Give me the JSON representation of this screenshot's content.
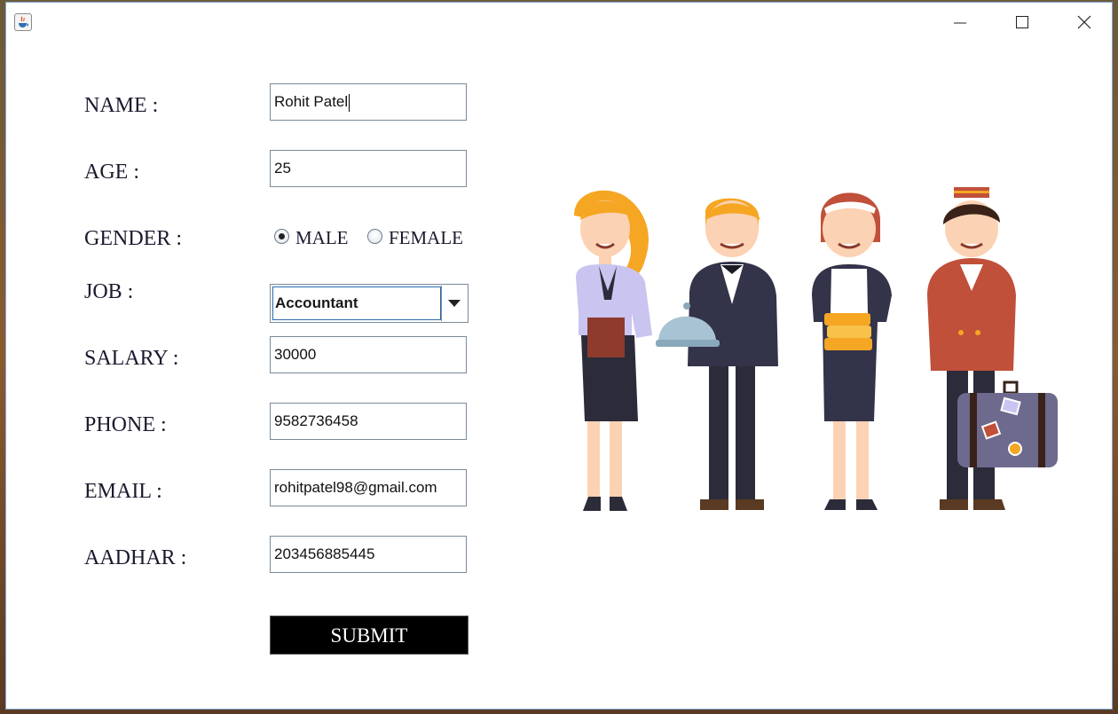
{
  "window": {
    "controls": {
      "minimize": "minimize",
      "maximize": "maximize",
      "close": "close"
    }
  },
  "form": {
    "name": {
      "label": "NAME :",
      "value": "Rohit Patel"
    },
    "age": {
      "label": "AGE :",
      "value": "25"
    },
    "gender": {
      "label": "GENDER :",
      "options": [
        {
          "label": "MALE",
          "selected": true
        },
        {
          "label": "FEMALE",
          "selected": false
        }
      ]
    },
    "job": {
      "label": "JOB :",
      "selected": "Accountant"
    },
    "salary": {
      "label": "SALARY :",
      "value": "30000"
    },
    "phone": {
      "label": "PHONE :",
      "value": "9582736458"
    },
    "email": {
      "label": "EMAIL :",
      "value": "rohitpatel98@gmail.com"
    },
    "aadhar": {
      "label": "AADHAR :",
      "value": "203456885445"
    },
    "submit_label": "SUBMIT"
  },
  "icons": {
    "app": "java-app-icon",
    "minimize": "minimize-icon",
    "maximize": "maximize-icon",
    "close": "close-icon",
    "dropdown": "chevron-down-icon"
  },
  "colors": {
    "window_bg": "#ffffff",
    "submit_bg": "#000000",
    "submit_text": "#ffffff",
    "label_text": "#1a1a2e"
  }
}
